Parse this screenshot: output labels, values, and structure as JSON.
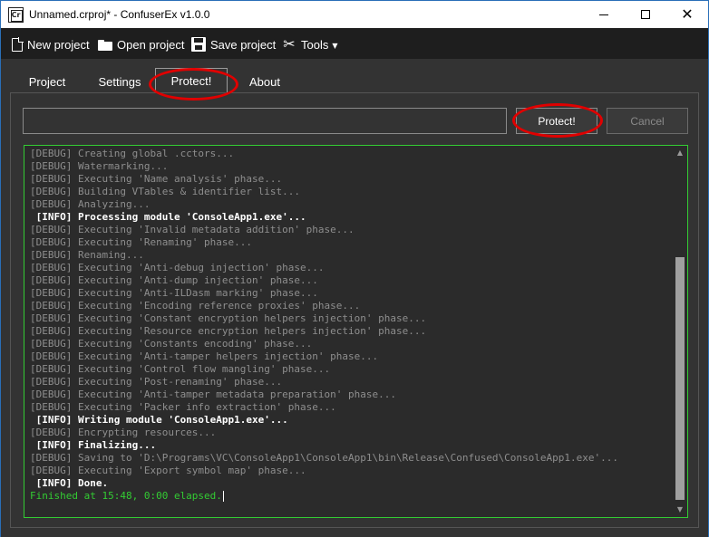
{
  "window": {
    "title": "Unnamed.crproj* - ConfuserEx v1.0.0",
    "icon_label": "Cr"
  },
  "toolbar": {
    "new_project": "New project",
    "open_project": "Open project",
    "save_project": "Save project",
    "tools": "Tools"
  },
  "tabs": [
    {
      "label": "Project"
    },
    {
      "label": "Settings"
    },
    {
      "label": "Protect!",
      "selected": true
    },
    {
      "label": "About"
    }
  ],
  "protect_panel": {
    "path_value": "",
    "protect_button": "Protect!",
    "cancel_button": "Cancel"
  },
  "log": {
    "lines": [
      {
        "level": "debug",
        "text": "[DEBUG] Creating global .cctors..."
      },
      {
        "level": "debug",
        "text": "[DEBUG] Watermarking..."
      },
      {
        "level": "debug",
        "text": "[DEBUG] Executing 'Name analysis' phase..."
      },
      {
        "level": "debug",
        "text": "[DEBUG] Building VTables & identifier list..."
      },
      {
        "level": "debug",
        "text": "[DEBUG] Analyzing..."
      },
      {
        "level": "info",
        "text": " [INFO] Processing module 'ConsoleApp1.exe'..."
      },
      {
        "level": "debug",
        "text": "[DEBUG] Executing 'Invalid metadata addition' phase..."
      },
      {
        "level": "debug",
        "text": "[DEBUG] Executing 'Renaming' phase..."
      },
      {
        "level": "debug",
        "text": "[DEBUG] Renaming..."
      },
      {
        "level": "debug",
        "text": "[DEBUG] Executing 'Anti-debug injection' phase..."
      },
      {
        "level": "debug",
        "text": "[DEBUG] Executing 'Anti-dump injection' phase..."
      },
      {
        "level": "debug",
        "text": "[DEBUG] Executing 'Anti-ILDasm marking' phase..."
      },
      {
        "level": "debug",
        "text": "[DEBUG] Executing 'Encoding reference proxies' phase..."
      },
      {
        "level": "debug",
        "text": "[DEBUG] Executing 'Constant encryption helpers injection' phase..."
      },
      {
        "level": "debug",
        "text": "[DEBUG] Executing 'Resource encryption helpers injection' phase..."
      },
      {
        "level": "debug",
        "text": "[DEBUG] Executing 'Constants encoding' phase..."
      },
      {
        "level": "debug",
        "text": "[DEBUG] Executing 'Anti-tamper helpers injection' phase..."
      },
      {
        "level": "debug",
        "text": "[DEBUG] Executing 'Control flow mangling' phase..."
      },
      {
        "level": "debug",
        "text": "[DEBUG] Executing 'Post-renaming' phase..."
      },
      {
        "level": "debug",
        "text": "[DEBUG] Executing 'Anti-tamper metadata preparation' phase..."
      },
      {
        "level": "debug",
        "text": "[DEBUG] Executing 'Packer info extraction' phase..."
      },
      {
        "level": "info",
        "text": " [INFO] Writing module 'ConsoleApp1.exe'..."
      },
      {
        "level": "debug",
        "text": "[DEBUG] Encrypting resources..."
      },
      {
        "level": "info",
        "text": " [INFO] Finalizing..."
      },
      {
        "level": "debug",
        "text": "[DEBUG] Saving to 'D:\\Programs\\VC\\ConsoleApp1\\ConsoleApp1\\bin\\Release\\Confused\\ConsoleApp1.exe'..."
      },
      {
        "level": "debug",
        "text": "[DEBUG] Executing 'Export symbol map' phase..."
      },
      {
        "level": "info",
        "text": " [INFO] Done."
      },
      {
        "level": "ok",
        "text": "Finished at 15:48, 0:00 elapsed."
      }
    ]
  },
  "colors": {
    "client_bg": "#333333",
    "toolbar_bg": "#1e1e1e",
    "log_border": "#33cc33",
    "debug_text": "#8e8e8e",
    "finished_text": "#33cc33",
    "annotation": "#e00000"
  }
}
